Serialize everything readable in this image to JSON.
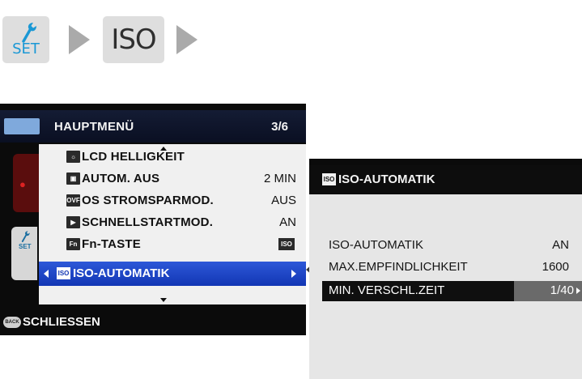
{
  "breadcrumb": {
    "step1": {
      "icon": "wrench-icon",
      "label": "SET"
    },
    "step2": {
      "label": "ISO"
    }
  },
  "colors": {
    "set_accent": "#1a98d5",
    "selection_blue": "#1236b4",
    "crumb_box": "#dedede",
    "arrow": "#aaaaaa"
  },
  "main_menu": {
    "title": "HAUPTMENÜ",
    "page": "3/6",
    "items": [
      {
        "icon": "lcd-brightness-icon",
        "label": "LCD HELLIGKEIT",
        "value": ""
      },
      {
        "icon": "auto-off-icon",
        "label": "AUTOM. AUS",
        "value": "2 MIN"
      },
      {
        "icon": "ovf-icon",
        "icon_text": "OVF",
        "label": "OS STROMSPARMOD.",
        "value": "AUS"
      },
      {
        "icon": "quick-start-icon",
        "label": "SCHNELLSTARTMOD.",
        "value": "AN"
      },
      {
        "icon": "fn-icon",
        "icon_text": "Fn",
        "label": "Fn-TASTE",
        "value_icon": "ISO"
      }
    ],
    "selected_item": {
      "icon": "iso-icon",
      "icon_text": "ISO",
      "label": "ISO-AUTOMATIK"
    },
    "back_button": {
      "icon_text": "BACK",
      "label": "SCHLIESSEN"
    }
  },
  "sub_menu": {
    "title_icon_text": "ISO",
    "title": "ISO-AUTOMATIK",
    "items": [
      {
        "label": "ISO-AUTOMATIK",
        "value": "AN"
      },
      {
        "label": "MAX.EMPFINDLICHKEIT",
        "value": "1600"
      }
    ],
    "selected_item": {
      "label": "MIN. VERSCHL.ZEIT",
      "value": "1/40"
    }
  }
}
